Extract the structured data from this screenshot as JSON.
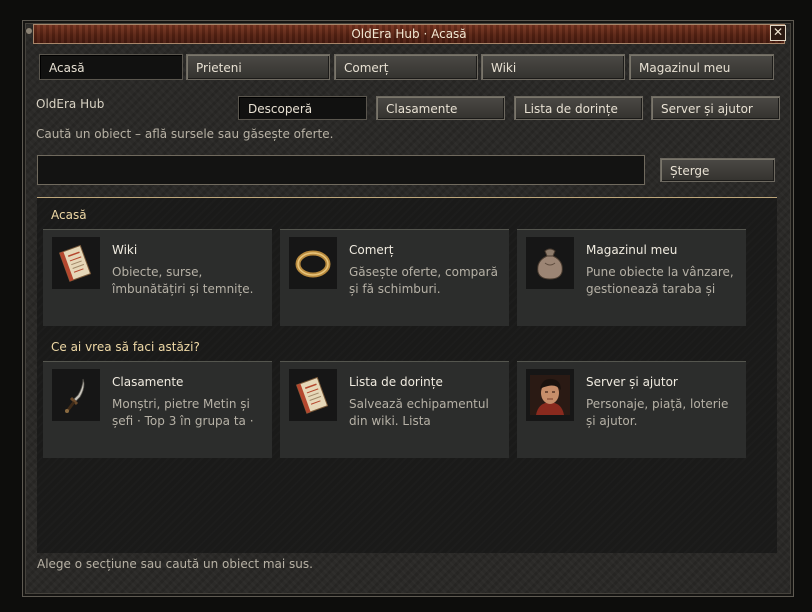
{
  "window": {
    "title": "OldEra Hub · Acasă",
    "close_label": "✕"
  },
  "nav_tabs": [
    {
      "label": "Acasă",
      "active": true
    },
    {
      "label": "Prieteni",
      "active": false
    },
    {
      "label": "Comerț",
      "active": false
    },
    {
      "label": "Wiki",
      "active": false
    },
    {
      "label": "Magazinul meu",
      "active": false
    }
  ],
  "hub_label": "OldEra Hub",
  "sub_tabs": [
    {
      "label": "Descoperă",
      "active": true
    },
    {
      "label": "Clasamente",
      "active": false
    },
    {
      "label": "Lista de dorințe",
      "active": false
    },
    {
      "label": "Server și ajutor",
      "active": false
    }
  ],
  "search": {
    "hint": "Caută un obiect – află sursele sau găsește oferte.",
    "value": "",
    "placeholder": "",
    "clear_label": "Șterge"
  },
  "home": {
    "section_title": "Acasă",
    "cards": [
      {
        "icon": "book-icon",
        "title": "Wiki",
        "desc": "Obiecte, surse, îmbunătățiri și temnițe."
      },
      {
        "icon": "ring-icon",
        "title": "Comerț",
        "desc": "Găsește oferte, compară și fă schimburi."
      },
      {
        "icon": "bag-icon",
        "title": "Magazinul meu",
        "desc": "Pune obiecte la vânzare, gestionează taraba și"
      }
    ]
  },
  "actions": {
    "section_title": "Ce ai vrea să faci astăzi?",
    "cards": [
      {
        "icon": "sword-icon",
        "title": "Clasamente",
        "desc": "Monștri, pietre Metin și șefi · Top 3 în grupa ta ·"
      },
      {
        "icon": "book-icon",
        "title": "Lista de dorințe",
        "desc": "Salvează echipamentul din wiki. Lista personajului"
      },
      {
        "icon": "warrior-portrait-icon",
        "title": "Server și ajutor",
        "desc": "Personaje, piață, loterie și ajutor."
      }
    ]
  },
  "status_text": "Alege o secțiune sau caută un obiect mai sus.",
  "colors": {
    "title_bar": "#5a2414",
    "section_title": "#efd9a6",
    "panel_border": "#bca57a"
  }
}
